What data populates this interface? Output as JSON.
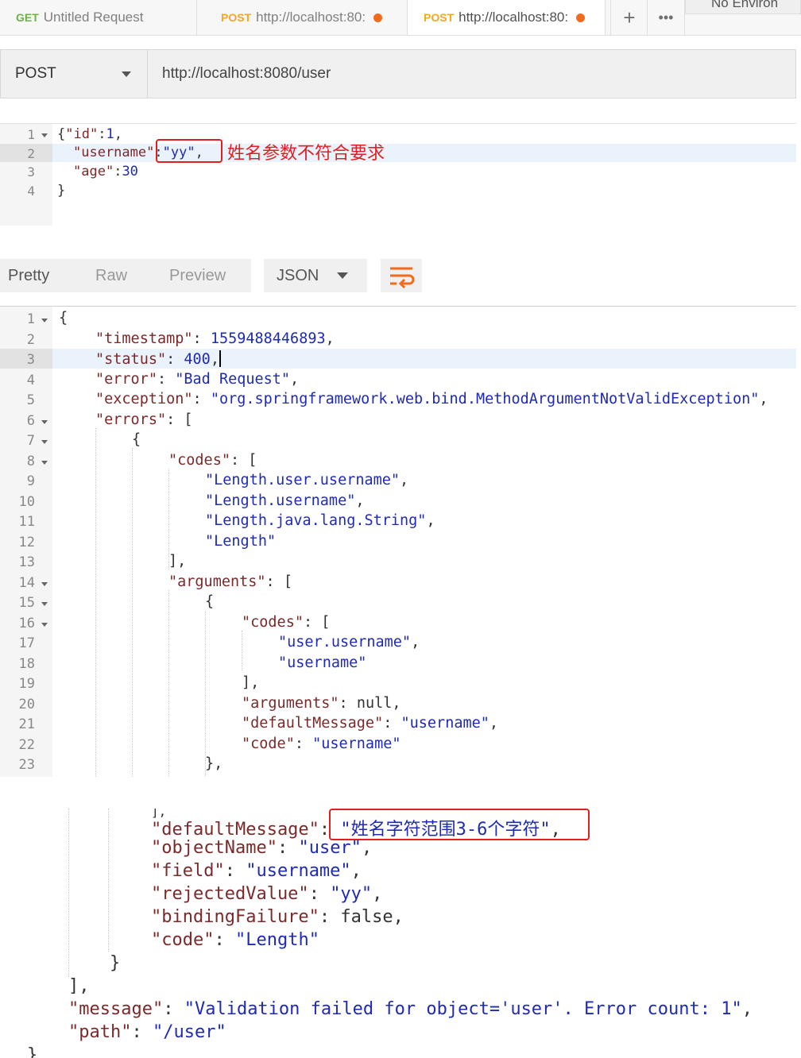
{
  "tabs": [
    {
      "method": "GET",
      "label": "Untitled Request"
    },
    {
      "method": "POST",
      "label": "http://localhost:80:"
    },
    {
      "method": "POST",
      "label": "http://localhost:80:"
    }
  ],
  "toolbar": {
    "add_icon": "+",
    "more_icon": "•••",
    "environment": "No Environ"
  },
  "request": {
    "method": "POST",
    "url": "http://localhost:8080/user"
  },
  "request_body": {
    "line_numbers": [
      "1",
      "2",
      "3",
      "4"
    ],
    "l1": {
      "open": "{",
      "k": "\"id\"",
      "sep": ":",
      "v": "1",
      "end": ","
    },
    "l2": {
      "k": "\"username\"",
      "sep": ":",
      "v": "\"yy\"",
      "end": ","
    },
    "l3": {
      "k": "\"age\"",
      "sep": ":",
      "v": "30"
    },
    "l4": {
      "close": "}"
    }
  },
  "annotation_body": "姓名参数不符合要求",
  "response_tabs": {
    "pretty": "Pretty",
    "raw": "Raw",
    "preview": "Preview",
    "format": "JSON",
    "wrap_icon": "wrap-icon"
  },
  "response_lines": {
    "nums": [
      "1",
      "2",
      "3",
      "4",
      "5",
      "6",
      "7",
      "8",
      "9",
      "10",
      "11",
      "12",
      "13",
      "14",
      "15",
      "16",
      "17",
      "18",
      "19",
      "20",
      "21",
      "22",
      "23"
    ],
    "l1": "{",
    "l2k": "\"timestamp\"",
    "l2v": "1559488446893",
    "l3k": "\"status\"",
    "l3v": "400",
    "l4k": "\"error\"",
    "l4v": "\"Bad Request\"",
    "l5k": "\"exception\"",
    "l5v": "\"org.springframework.web.bind.MethodArgumentNotValidException\"",
    "l6k": "\"errors\"",
    "l6v": "[",
    "l7": "{",
    "l8k": "\"codes\"",
    "l8v": "[",
    "l9": "\"Length.user.username\"",
    "l10": "\"Length.username\"",
    "l11": "\"Length.java.lang.String\"",
    "l12": "\"Length\"",
    "l13": "],",
    "l14k": "\"arguments\"",
    "l14v": "[",
    "l15": "{",
    "l16k": "\"codes\"",
    "l16v": "[",
    "l17": "\"user.username\"",
    "l18": "\"username\"",
    "l19": "],",
    "l20k": "\"arguments\"",
    "l20v": "null",
    "l21k": "\"defaultMessage\"",
    "l21v": "\"username\"",
    "l22k": "\"code\"",
    "l22v": "\"username\"",
    "l23": "},"
  },
  "response_tail": {
    "t0": "],",
    "t1k": "\"defaultMessage\"",
    "t1v": "\"姓名字符范围3-6个字符\"",
    "t2k": "\"objectName\"",
    "t2v": "\"user\"",
    "t3k": "\"field\"",
    "t3v": "\"username\"",
    "t4k": "\"rejectedValue\"",
    "t4v": "\"yy\"",
    "t5k": "\"bindingFailure\"",
    "t5v": "false",
    "t6k": "\"code\"",
    "t6v": "\"Length\"",
    "t7": "}",
    "t8": "],",
    "t9k": "\"message\"",
    "t9v": "\"Validation failed for object='user'. Error count: 1\"",
    "t10k": "\"path\"",
    "t10v": "\"/user\"",
    "t11": "}"
  }
}
